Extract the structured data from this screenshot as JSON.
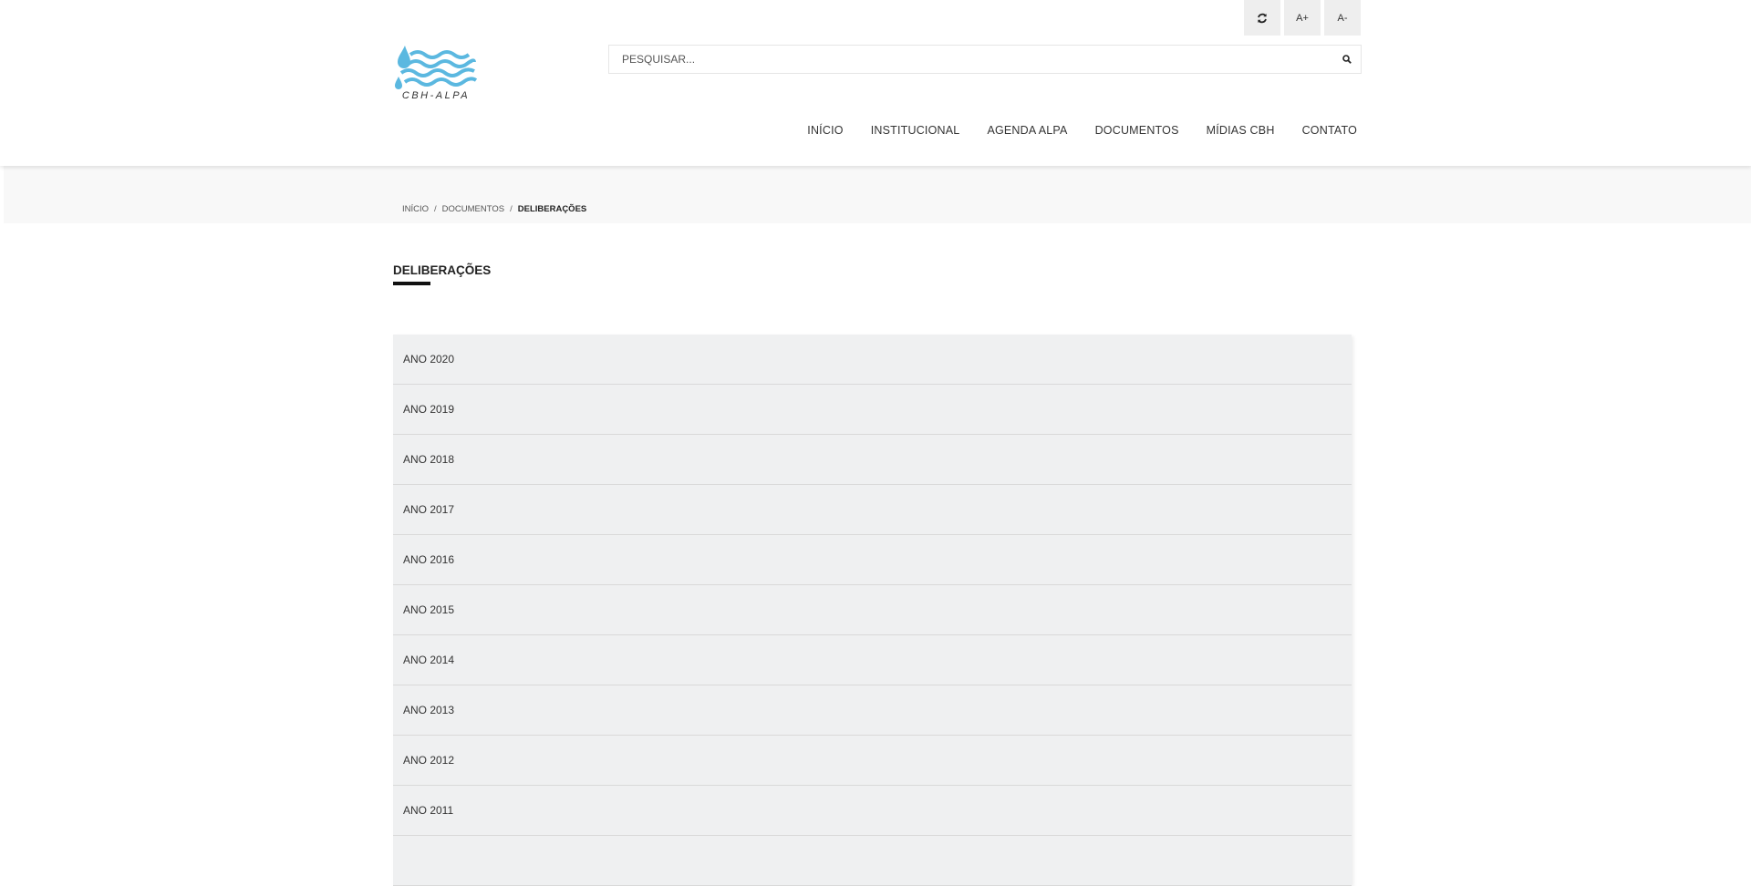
{
  "accessibility": {
    "refresh_icon": "refresh-icon",
    "increase_font": "A+",
    "decrease_font": "A-"
  },
  "logo": {
    "text": "CBH-ALPA",
    "colors": {
      "waves": "#5bb8e0",
      "text": "#333333"
    }
  },
  "search": {
    "placeholder": "PESQUISAR...",
    "value": "",
    "icon": "search-icon"
  },
  "nav": {
    "items": [
      {
        "label": "INÍCIO"
      },
      {
        "label": "INSTITUCIONAL"
      },
      {
        "label": "AGENDA ALPA"
      },
      {
        "label": "DOCUMENTOS"
      },
      {
        "label": "MÍDIAS CBH"
      },
      {
        "label": "CONTATO"
      }
    ]
  },
  "breadcrumb": {
    "home": "INÍCIO",
    "parent": "DOCUMENTOS",
    "current": "DELIBERAÇÕES",
    "separator": "/"
  },
  "page": {
    "title": "DELIBERAÇÕES"
  },
  "years": {
    "items": [
      {
        "label": "ANO 2020"
      },
      {
        "label": "ANO 2019"
      },
      {
        "label": "ANO 2018"
      },
      {
        "label": "ANO 2017"
      },
      {
        "label": "ANO 2016"
      },
      {
        "label": "ANO 2015"
      },
      {
        "label": "ANO 2014"
      },
      {
        "label": "ANO 2013"
      },
      {
        "label": "ANO 2012"
      },
      {
        "label": "ANO 2011"
      },
      {
        "label": ""
      }
    ]
  },
  "colors": {
    "list_background": "#eff0f1",
    "band_background": "#f8f8f8",
    "accent": "#111111"
  }
}
